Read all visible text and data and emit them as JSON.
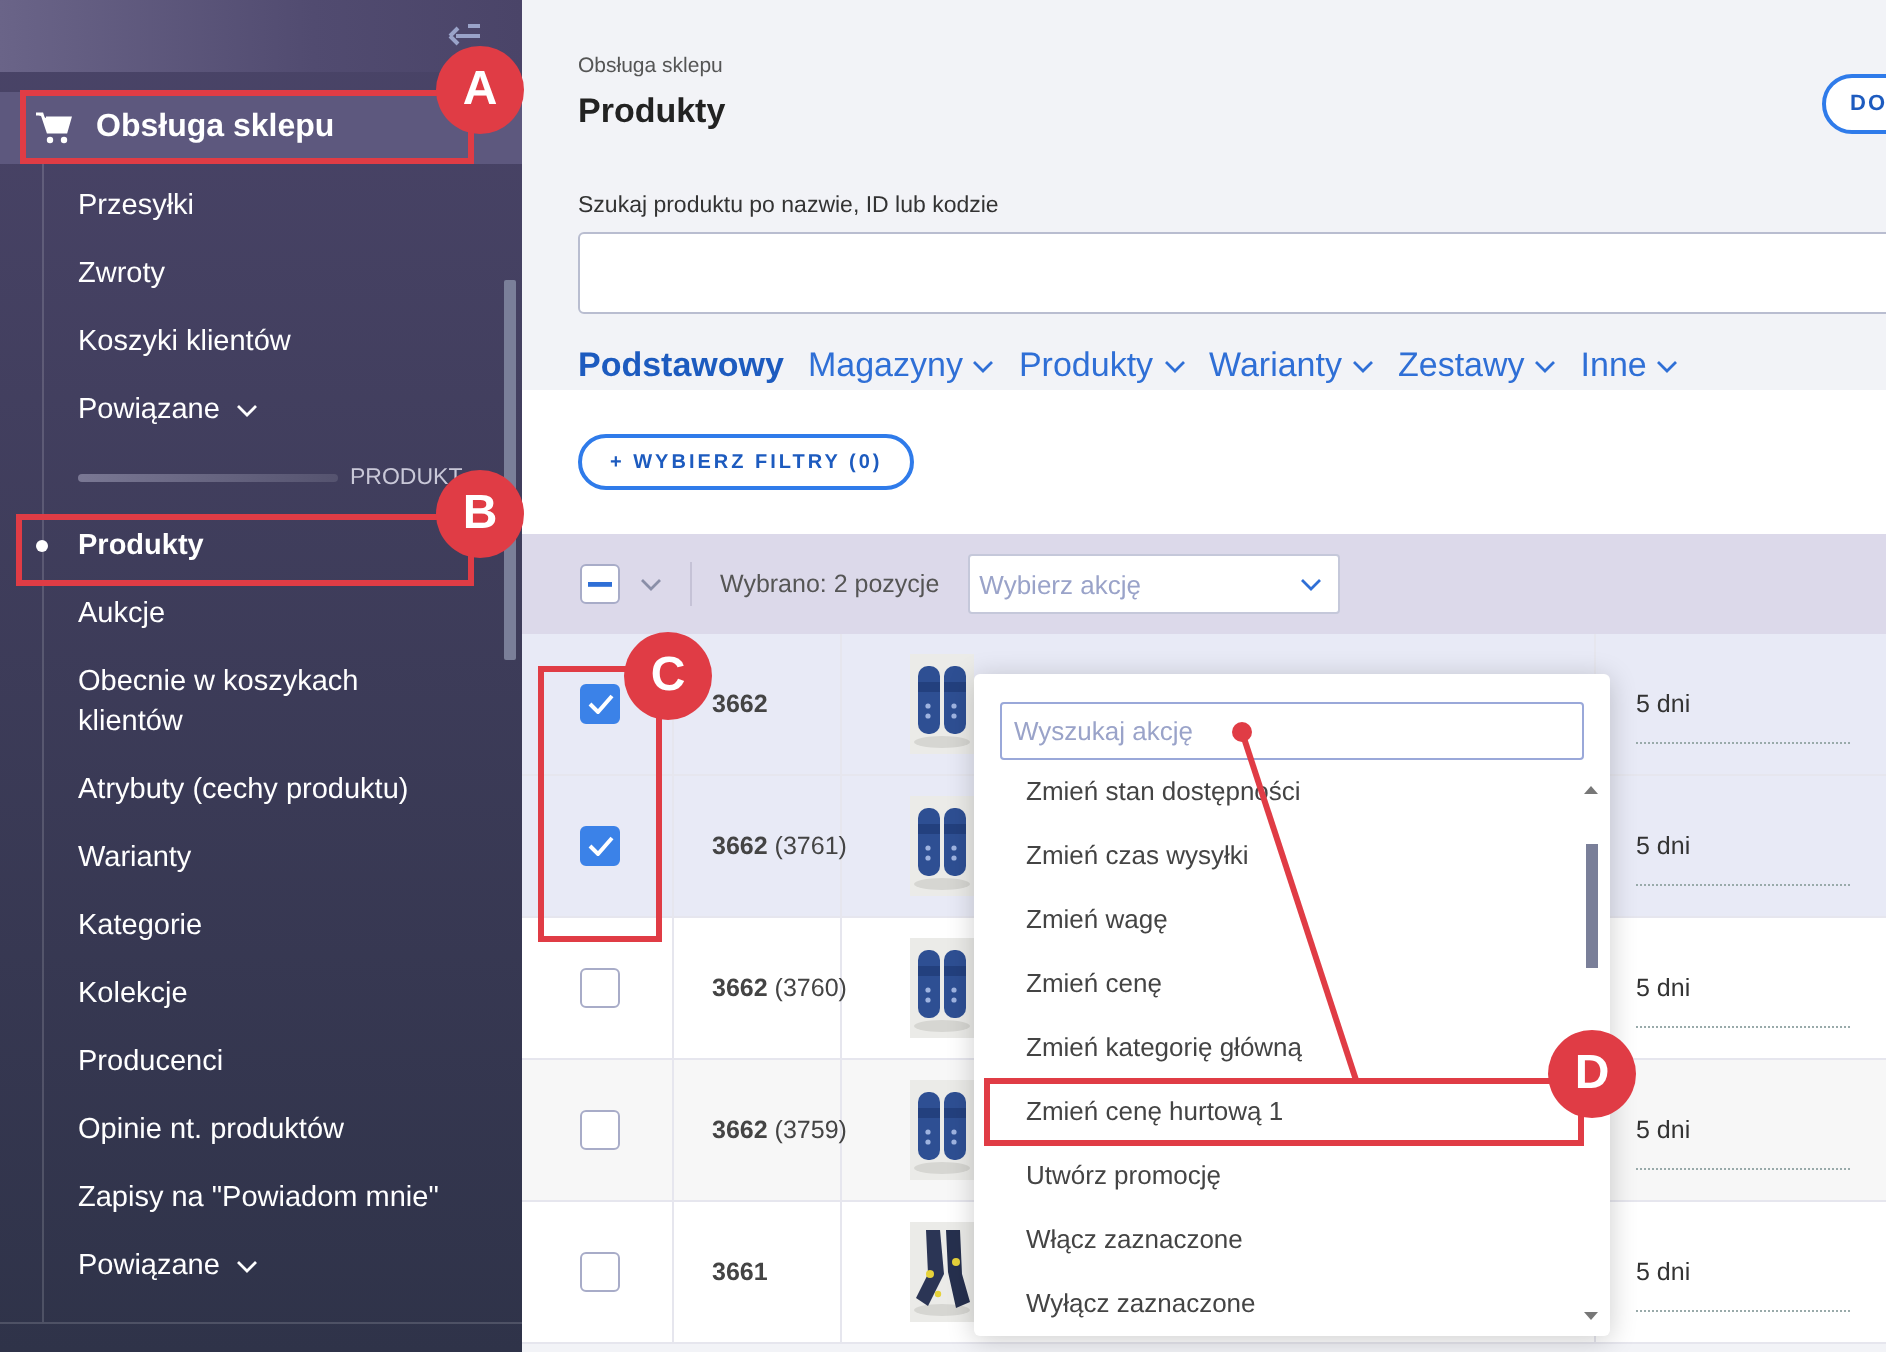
{
  "sidebar": {
    "section": {
      "label": "Obsługa sklepu",
      "selected": true
    },
    "items": [
      {
        "kind": "link",
        "label": "Przesyłki",
        "selected": false
      },
      {
        "kind": "link",
        "label": "Zwroty",
        "selected": false
      },
      {
        "kind": "link",
        "label": "Koszyki klientów",
        "selected": false
      },
      {
        "kind": "menu",
        "label": "Powiązane",
        "selected": false
      },
      {
        "kind": "divider",
        "label": "PRODUKT"
      },
      {
        "kind": "link",
        "label": "Produkty",
        "selected": true
      },
      {
        "kind": "link",
        "label": "Aukcje",
        "selected": false
      },
      {
        "kind": "link",
        "label": "Obecnie w koszykach klientów",
        "selected": false
      },
      {
        "kind": "link",
        "label": "Atrybuty (cechy produktu)",
        "selected": false
      },
      {
        "kind": "link",
        "label": "Warianty",
        "selected": false
      },
      {
        "kind": "link",
        "label": "Kategorie",
        "selected": false
      },
      {
        "kind": "link",
        "label": "Kolekcje",
        "selected": false
      },
      {
        "kind": "link",
        "label": "Producenci",
        "selected": false
      },
      {
        "kind": "link",
        "label": "Opinie nt. produktów",
        "selected": false
      },
      {
        "kind": "link",
        "label": "Zapisy na \"Powiadom mnie\"",
        "selected": false
      },
      {
        "kind": "menu",
        "label": "Powiązane",
        "selected": false
      }
    ]
  },
  "header": {
    "breadcrumb": "Obsługa sklepu",
    "title": "Produkty",
    "button": "DO"
  },
  "search": {
    "label": "Szukaj produktu po nazwie, ID lub kodzie"
  },
  "tabs": [
    {
      "label": "Podstawowy",
      "selected": true,
      "menu": false
    },
    {
      "label": "Magazyny",
      "selected": false,
      "menu": true
    },
    {
      "label": "Produkty",
      "selected": false,
      "menu": true
    },
    {
      "label": "Warianty",
      "selected": false,
      "menu": true
    },
    {
      "label": "Zestawy",
      "selected": false,
      "menu": true
    },
    {
      "label": "Inne",
      "selected": false,
      "menu": true
    }
  ],
  "filter_button": "+ WYBIERZ FILTRY (0)",
  "bulk_bar": {
    "indeterminate": true,
    "count": "Wybrano: 2 pozycje",
    "action_placeholder": "Wybierz akcję"
  },
  "rows": [
    {
      "checked": true,
      "id": "3662",
      "variant": "",
      "delivery": "5 dni"
    },
    {
      "checked": true,
      "id": "3662",
      "variant": "(3761)",
      "delivery": "5 dni"
    },
    {
      "checked": false,
      "id": "3662",
      "variant": "(3760)",
      "delivery": "5 dni"
    },
    {
      "checked": false,
      "id": "3662",
      "variant": "(3759)",
      "delivery": "5 dni"
    },
    {
      "checked": false,
      "id": "3661",
      "variant": "",
      "delivery": "5 dni"
    }
  ],
  "action_menu": {
    "search_placeholder": "Wyszukaj akcję",
    "items": [
      "Zmień stan dostępności",
      "Zmień czas wysyłki",
      "Zmień wagę",
      "Zmień cenę",
      "Zmień kategorię główną",
      "Zmień cenę hurtową 1",
      "Utwórz promocję",
      "Włącz zaznaczone",
      "Wyłącz zaznaczone"
    ]
  },
  "annotations": [
    {
      "label": "A"
    },
    {
      "label": "B"
    },
    {
      "label": "C"
    },
    {
      "label": "D"
    }
  ]
}
